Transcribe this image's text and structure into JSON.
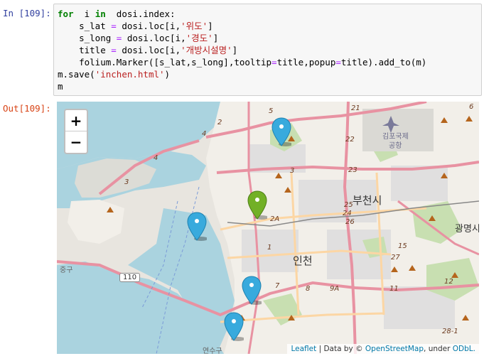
{
  "cell": {
    "in_prompt": "In [109]:",
    "out_prompt": "Out[109]:",
    "code_lines": [
      {
        "parts": [
          [
            "kw",
            "for"
          ],
          [
            "",
            "  i "
          ],
          [
            "kw",
            "in"
          ],
          [
            "",
            "  dosi.index:"
          ]
        ]
      },
      {
        "parts": [
          [
            "",
            "    s_lat "
          ],
          [
            "op",
            "="
          ],
          [
            "",
            " dosi.loc[i,"
          ],
          [
            "str",
            "'위도'"
          ],
          [
            "",
            "]"
          ]
        ]
      },
      {
        "parts": [
          [
            "",
            "    s_long "
          ],
          [
            "op",
            "="
          ],
          [
            "",
            " dosi.loc[i,"
          ],
          [
            "str",
            "'경도'"
          ],
          [
            "",
            "]"
          ]
        ]
      },
      {
        "parts": [
          [
            "",
            "    title "
          ],
          [
            "op",
            "="
          ],
          [
            "",
            " dosi.loc[i,"
          ],
          [
            "str",
            "'개방시설명'"
          ],
          [
            "",
            "]"
          ]
        ]
      },
      {
        "parts": [
          [
            "",
            "    folium.Marker([s_lat,s_long],tooltip"
          ],
          [
            "op",
            "="
          ],
          [
            "",
            "title,popup"
          ],
          [
            "op",
            "="
          ],
          [
            "",
            "title).add_to(m)"
          ]
        ]
      },
      {
        "parts": [
          [
            "",
            "m.save("
          ],
          [
            "str",
            "'inchen.html'"
          ],
          [
            "",
            ")"
          ]
        ]
      },
      {
        "parts": [
          [
            "",
            "m"
          ]
        ]
      }
    ]
  },
  "map": {
    "zoom_in_label": "+",
    "zoom_out_label": "−",
    "attribution": {
      "leaflet": "Leaflet",
      "sep1": " | Data by © ",
      "osm": "OpenStreetMap",
      "sep2": ", under ",
      "odbl": "ODbL."
    },
    "labels": {
      "bucheon": "부천시",
      "incheon": "인천",
      "gwangmyeong": "광명시",
      "gimpo_airport_1": "김포국제",
      "gimpo_airport_2": "공항",
      "junggu": "중구",
      "yeonsugu": "연수구"
    },
    "road_numbers": [
      "2",
      "4",
      "5",
      "3",
      "21",
      "22",
      "23",
      "25",
      "26",
      "24",
      "2A",
      "1",
      "27",
      "15",
      "7",
      "8",
      "9A",
      "11",
      "12",
      "6",
      "110",
      "3",
      "28-1",
      "4"
    ],
    "markers": [
      {
        "color": "#38aadd",
        "icon": "info-icon-blue"
      },
      {
        "color": "#38aadd",
        "icon": "info-icon-blue"
      },
      {
        "color": "#72b026",
        "icon": "info-icon-green"
      },
      {
        "color": "#38aadd",
        "icon": "info-icon-blue"
      },
      {
        "color": "#38aadd",
        "icon": "info-icon-blue"
      }
    ]
  }
}
